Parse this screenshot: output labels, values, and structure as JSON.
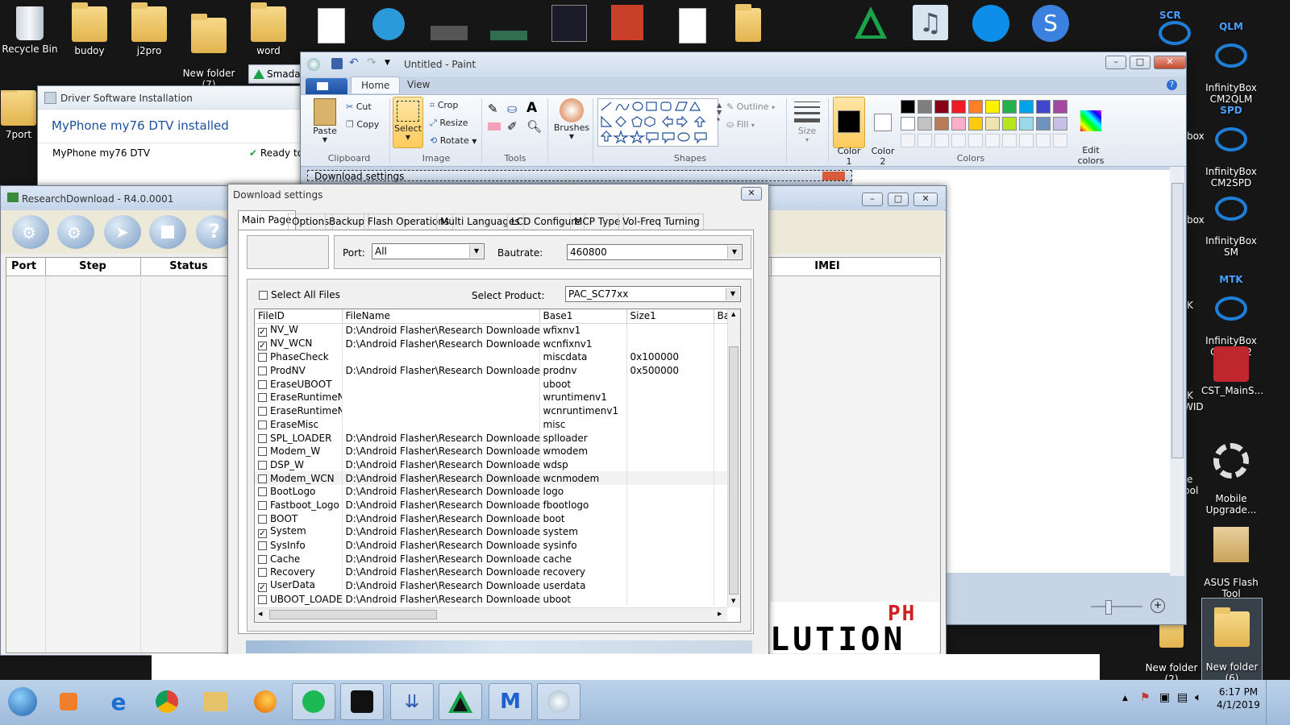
{
  "desktop": {
    "icons_left": [
      {
        "label": "Recycle Bin",
        "icon": "recycle-bin-icon"
      },
      {
        "label": "budoy",
        "icon": "folder-icon"
      },
      {
        "label": "j2pro",
        "icon": "folder-icon"
      },
      {
        "label": "New folder\n(7)",
        "icon": "folder-icon"
      },
      {
        "label": "word",
        "icon": "folder-icon"
      },
      {
        "label": "7port",
        "icon": "folder-icon"
      }
    ],
    "icons_right": [
      {
        "badge": "SCR",
        "label": "",
        "icon": "infinitybox-icon"
      },
      {
        "badge": "QLM",
        "label": "InfinityBox\nCM2QLM",
        "icon": "infinitybox-icon"
      },
      {
        "badge": "SPD",
        "label": "InfinityBox\nCM2SPD",
        "icon": "infinitybox-icon"
      },
      {
        "badge": "",
        "label": "InfinityBox\nSM",
        "icon": "infinitybox-icon"
      },
      {
        "badge": "MTK",
        "label": "InfinityBox\nCM2MT2",
        "icon": "infinitybox-icon"
      },
      {
        "badge": "",
        "label": "CST_MainS...",
        "icon": "cst-icon"
      },
      {
        "badge": "",
        "label": "Mobile\nUpgrade...",
        "icon": "gear-icon"
      },
      {
        "badge": "",
        "label": "ASUS Flash\nTool",
        "icon": "box-icon"
      },
      {
        "badge": "",
        "label": "New folder\n(2)",
        "icon": "folder-icon"
      },
      {
        "badge": "",
        "label": "New folder\n(6)",
        "icon": "folder-icon"
      }
    ],
    "partial_labels": {
      "smadav_tab": "Smada",
      "box": "box",
      "x": "x",
      "k": "K",
      "wid": "WID",
      "e": "e",
      "bol": "bol"
    }
  },
  "driver_window": {
    "title": "Driver Software Installation",
    "heading": "MyPhone my76 DTV installed",
    "device": "MyPhone my76 DTV",
    "status": "Ready to"
  },
  "paint": {
    "title": "Untitled - Paint",
    "tabs": [
      "Home",
      "View"
    ],
    "clipboard": {
      "paste": "Paste",
      "cut": "Cut",
      "copy": "Copy",
      "label": "Clipboard"
    },
    "image": {
      "select": "Select",
      "crop": "Crop",
      "resize": "Resize",
      "rotate": "Rotate",
      "label": "Image"
    },
    "tools": {
      "label": "Tools"
    },
    "brushes": {
      "label": "Brushes"
    },
    "shapes": {
      "outline": "Outline",
      "fill": "Fill",
      "label": "Shapes"
    },
    "size": {
      "label": "Size"
    },
    "colors": {
      "color1": "Color\n1",
      "color2": "Color\n2",
      "edit": "Edit\ncolors",
      "label": "Colors",
      "palette_row1": [
        "#000000",
        "#7f7f7f",
        "#880015",
        "#ed1c24",
        "#ff7f27",
        "#fff200",
        "#22b14c",
        "#00a2e8",
        "#3f48cc",
        "#a349a4"
      ],
      "palette_row2": [
        "#ffffff",
        "#c3c3c3",
        "#b97a57",
        "#ffaec9",
        "#ffc90e",
        "#efe4b0",
        "#b5e61d",
        "#99d9ea",
        "#7092be",
        "#c8bfe7"
      ]
    },
    "canvas_caption": "Download settings"
  },
  "research_download": {
    "title": "ResearchDownload - R4.0.0001",
    "columns": [
      "Port",
      "Step",
      "Status"
    ],
    "imei_column": "IMEI"
  },
  "download_settings": {
    "title": "Download settings",
    "tabs": [
      "Main Page",
      "Options",
      "Backup",
      "Flash Operations",
      "Multi Languages",
      "LCD Configure",
      "MCP Type",
      "Vol-Freq Turning"
    ],
    "port_label": "Port:",
    "port_value": "All",
    "baudrate_label": "Bautrate:",
    "baudrate_value": "460800",
    "select_all": "Select All Files",
    "product_label": "Select Product:",
    "product_value": "PAC_SC77xx",
    "grid_headers": [
      "FileID",
      "FileName",
      "Base1",
      "Size1",
      "Ba"
    ],
    "rows": [
      {
        "checked": true,
        "id": "NV_W",
        "file": "D:\\Android Flasher\\Research Downloader\\SPD...",
        "base": "wfixnv1",
        "size": ""
      },
      {
        "checked": true,
        "id": "NV_WCN",
        "file": "D:\\Android Flasher\\Research Downloader\\SPD...",
        "base": "wcnfixnv1",
        "size": ""
      },
      {
        "checked": false,
        "id": "PhaseCheck",
        "file": "",
        "base": "miscdata",
        "size": "0x100000"
      },
      {
        "checked": false,
        "id": "ProdNV",
        "file": "D:\\Android Flasher\\Research Downloader\\SPD...",
        "base": "prodnv",
        "size": "0x500000"
      },
      {
        "checked": false,
        "id": "EraseUBOOT",
        "file": "",
        "base": "uboot",
        "size": ""
      },
      {
        "checked": false,
        "id": "EraseRuntimeN...",
        "file": "",
        "base": "wruntimenv1",
        "size": ""
      },
      {
        "checked": false,
        "id": "EraseRuntimeN...",
        "file": "",
        "base": "wcnruntimenv1",
        "size": ""
      },
      {
        "checked": false,
        "id": "EraseMisc",
        "file": "",
        "base": "misc",
        "size": ""
      },
      {
        "checked": false,
        "id": "SPL_LOADER",
        "file": "D:\\Android Flasher\\Research Downloader\\SPD...",
        "base": "splloader",
        "size": ""
      },
      {
        "checked": false,
        "id": "Modem_W",
        "file": "D:\\Android Flasher\\Research Downloader\\SPD...",
        "base": "wmodem",
        "size": ""
      },
      {
        "checked": false,
        "id": "DSP_W",
        "file": "D:\\Android Flasher\\Research Downloader\\SPD...",
        "base": "wdsp",
        "size": ""
      },
      {
        "checked": false,
        "id": "Modem_WCN",
        "file": "D:\\Android Flasher\\Research Downloader\\SPD...",
        "base": "wcnmodem",
        "size": ""
      },
      {
        "checked": false,
        "id": "BootLogo",
        "file": "D:\\Android Flasher\\Research Downloader\\SPD...",
        "base": "logo",
        "size": ""
      },
      {
        "checked": false,
        "id": "Fastboot_Logo",
        "file": "D:\\Android Flasher\\Research Downloader\\SPD...",
        "base": "fbootlogo",
        "size": ""
      },
      {
        "checked": false,
        "id": "BOOT",
        "file": "D:\\Android Flasher\\Research Downloader\\SPD...",
        "base": "boot",
        "size": ""
      },
      {
        "checked": true,
        "id": "System",
        "file": "D:\\Android Flasher\\Research Downloader\\SPD...",
        "base": "system",
        "size": ""
      },
      {
        "checked": false,
        "id": "SysInfo",
        "file": "D:\\Android Flasher\\Research Downloader\\SPD...",
        "base": "sysinfo",
        "size": ""
      },
      {
        "checked": false,
        "id": "Cache",
        "file": "D:\\Android Flasher\\Research Downloader\\SPD...",
        "base": "cache",
        "size": ""
      },
      {
        "checked": false,
        "id": "Recovery",
        "file": "D:\\Android Flasher\\Research Downloader\\SPD...",
        "base": "recovery",
        "size": ""
      },
      {
        "checked": true,
        "id": "UserData",
        "file": "D:\\Android Flasher\\Research Downloader\\SPD...",
        "base": "userdata",
        "size": ""
      },
      {
        "checked": false,
        "id": "UBOOT_LOADER",
        "file": "D:\\Android Flasher\\Research Downloader\\SPD...",
        "base": "uboot",
        "size": ""
      }
    ]
  },
  "logo_text": {
    "ph": "PH",
    "lution": "LUTION"
  },
  "taskbar": {
    "items": [
      "start-orb-icon",
      "media-player-icon",
      "internet-explorer-icon",
      "chrome-icon",
      "file-explorer-icon",
      "firefox-icon",
      "spotify-icon",
      "blackberry-icon",
      "research-download-icon",
      "smadav-icon",
      "malwarebytes-icon",
      "paint-icon"
    ],
    "time": "6:17 PM",
    "date": "4/1/2019"
  }
}
